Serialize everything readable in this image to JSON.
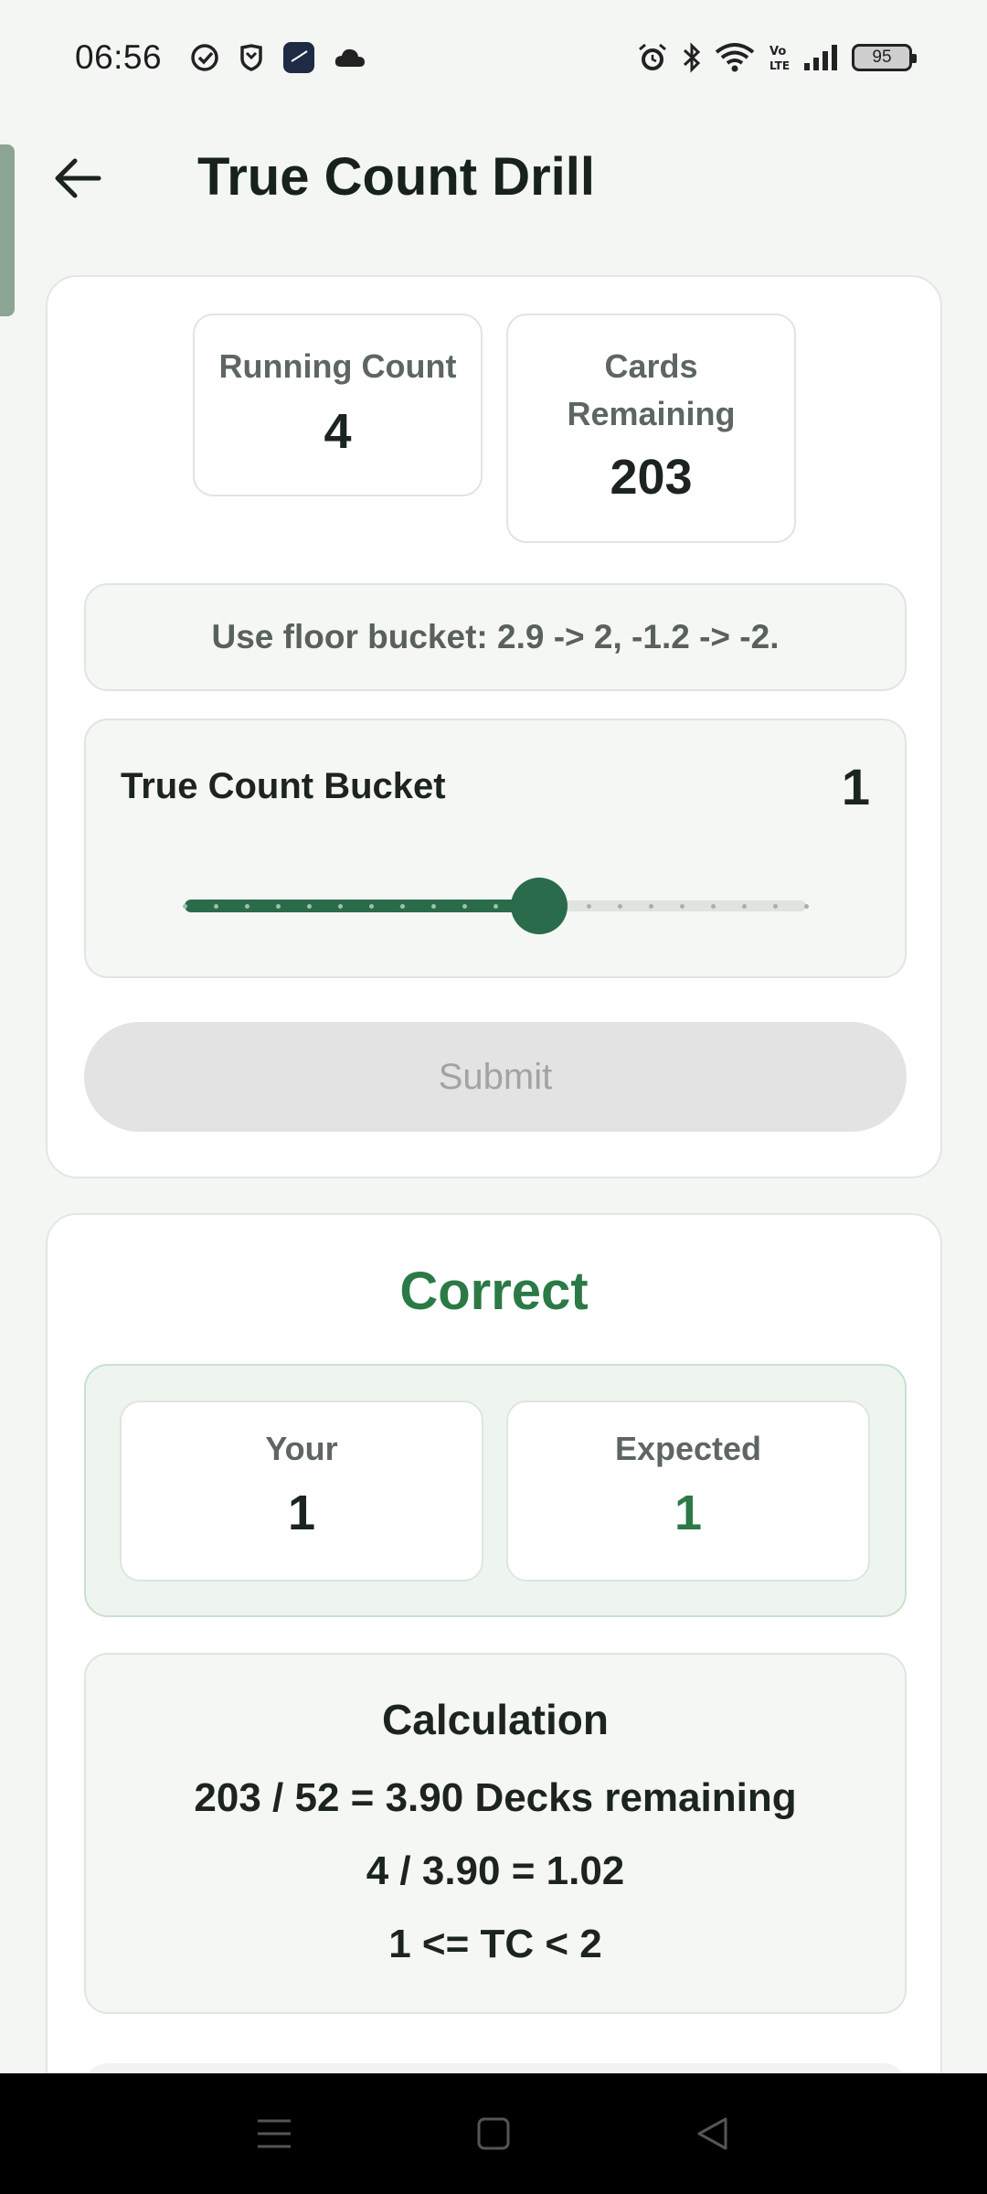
{
  "status_bar": {
    "time": "06:56",
    "battery": "95",
    "left_icons": [
      "check-circle-icon",
      "shield-icon",
      "clock-app-icon",
      "cloud-icon"
    ],
    "right_icons": [
      "alarm-icon",
      "bluetooth-icon",
      "wifi-icon",
      "volte-icon",
      "signal-icon",
      "battery-icon"
    ]
  },
  "header": {
    "title": "True Count Drill"
  },
  "stats": {
    "running_count_label": "Running Count",
    "running_count_value": "4",
    "cards_remaining_label_1": "Cards",
    "cards_remaining_label_2": "Remaining",
    "cards_remaining_value": "203"
  },
  "hint": "Use floor bucket: 2.9 -> 2, -1.2 -> -2.",
  "bucket": {
    "label": "True Count Bucket",
    "value": "1",
    "slider_fraction": 0.571,
    "steps": 21
  },
  "submit_label": "Submit",
  "result": {
    "title": "Correct",
    "your_label": "Your",
    "your_value": "1",
    "expected_label": "Expected",
    "expected_value": "1"
  },
  "calculation": {
    "title": "Calculation",
    "line1": "203 / 52 = 3.90 Decks remaining",
    "line2": "4 / 3.90 = 1.02",
    "line3": "1 <= TC < 2"
  },
  "colors": {
    "accent": "#2a6b4b",
    "correct": "#2b7a45"
  },
  "nav": [
    "menu-icon",
    "home-icon",
    "back-triangle-icon"
  ]
}
